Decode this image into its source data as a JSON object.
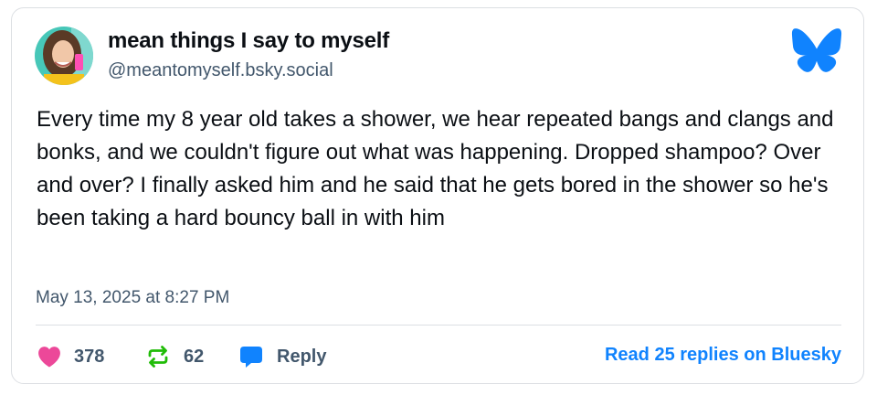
{
  "author": {
    "display_name": "mean things I say to myself",
    "handle": "@meantomyself.bsky.social",
    "avatar": "avatar-photo"
  },
  "post": {
    "text": "Every time my 8 year old takes a shower, we hear repeated bangs and clangs and bonks, and we couldn't figure out what was happening. Dropped shampoo? Over and over? I finally asked him and he said that he gets bored in the shower so he's been taking a hard bouncy ball in with him",
    "timestamp": "May 13, 2025 at 8:27 PM"
  },
  "engagement": {
    "likes": "378",
    "reposts": "62",
    "reply_label": "Reply",
    "read_replies_label": "Read 25 replies on Bluesky"
  },
  "icons": {
    "logo": "bluesky-butterfly-icon",
    "like": "heart-icon",
    "repost": "repost-icon",
    "reply": "speech-bubble-icon"
  },
  "colors": {
    "brand_blue": "#1083fe",
    "like_pink": "#ec4899",
    "repost_green": "#20bc07",
    "secondary_text": "#42576c"
  }
}
